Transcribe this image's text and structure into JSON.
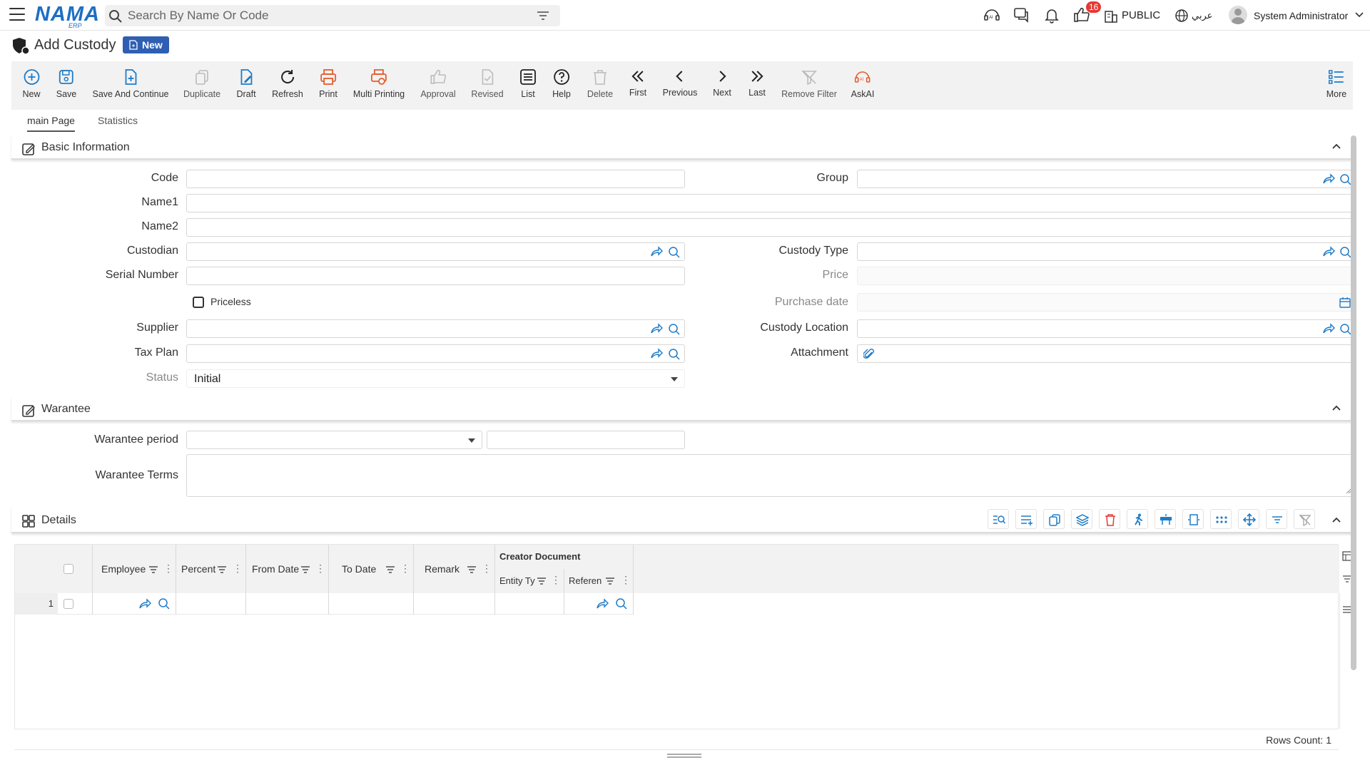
{
  "app": {
    "logo_text": "NAMA",
    "logo_sub": "ERP",
    "search_placeholder": "Search By Name Or Code",
    "notifications_count": "16",
    "public_label": "PUBLIC",
    "language_label": "عربي",
    "user_name": "System Administrator"
  },
  "page": {
    "title": "Add Custody",
    "badge": "New"
  },
  "toolbar": [
    {
      "label": "New",
      "icon": "plus-circle-icon"
    },
    {
      "label": "Save",
      "icon": "save-icon"
    },
    {
      "label": "Save And Continue",
      "icon": "save-continue-icon"
    },
    {
      "label": "Duplicate",
      "icon": "duplicate-icon"
    },
    {
      "label": "Draft",
      "icon": "draft-icon"
    },
    {
      "label": "Refresh",
      "icon": "refresh-icon"
    },
    {
      "label": "Print",
      "icon": "print-icon"
    },
    {
      "label": "Multi Printing",
      "icon": "multi-print-icon"
    },
    {
      "label": "Approval",
      "icon": "thumb-up-icon"
    },
    {
      "label": "Revised",
      "icon": "revised-icon"
    },
    {
      "label": "List",
      "icon": "list-icon"
    },
    {
      "label": "Help",
      "icon": "help-icon"
    },
    {
      "label": "Delete",
      "icon": "trash-icon"
    },
    {
      "label": "First",
      "icon": "double-chevron-left-icon"
    },
    {
      "label": "Previous",
      "icon": "chevron-left-icon"
    },
    {
      "label": "Next",
      "icon": "chevron-right-icon"
    },
    {
      "label": "Last",
      "icon": "double-chevron-right-icon"
    },
    {
      "label": "Remove Filter",
      "icon": "remove-filter-icon"
    },
    {
      "label": "AskAI",
      "icon": "ai-icon"
    },
    {
      "label": "More",
      "icon": "more-list-icon"
    }
  ],
  "tabs": [
    "main Page",
    "Statistics"
  ],
  "sections": {
    "basic": "Basic Information",
    "warantee": "Warantee",
    "details": "Details"
  },
  "form": {
    "code": "Code",
    "group": "Group",
    "name1": "Name1",
    "name2": "Name2",
    "custodian": "Custodian",
    "custody_type": "Custody Type",
    "serial_number": "Serial Number",
    "price": "Price",
    "priceless": "Priceless",
    "purchase_date": "Purchase date",
    "supplier": "Supplier",
    "custody_location": "Custody Location",
    "tax_plan": "Tax Plan",
    "attachment": "Attachment",
    "status": "Status",
    "status_value": "Initial",
    "warantee_period": "Warantee period",
    "warantee_terms": "Warantee Terms"
  },
  "grid": {
    "columns": [
      "Employee",
      "Percent",
      "From Date",
      "To Date",
      "Remark"
    ],
    "group_header": "Creator Document",
    "sub_columns": [
      "Entity Ty",
      "Referen"
    ],
    "row_number": "1",
    "rows_count": "Rows Count: 1"
  }
}
